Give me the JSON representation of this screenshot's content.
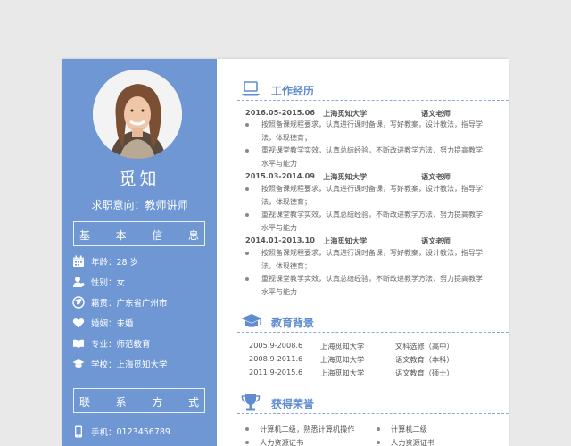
{
  "sidebar": {
    "name": "觅知",
    "intent": "求职意向：教师讲师",
    "basic_title": [
      "基",
      "本",
      "信",
      "息"
    ],
    "info": [
      {
        "icon": "calendar-icon",
        "label": "年龄：",
        "value": " 28 岁"
      },
      {
        "icon": "person-icon",
        "label": "性别：",
        "value": "女"
      },
      {
        "icon": "globe-icon",
        "label": "籍贯：",
        "value": "广东省广州市"
      },
      {
        "icon": "heart-icon",
        "label": "婚姻：",
        "value": "未婚"
      },
      {
        "icon": "book-icon",
        "label": "专业：",
        "value": "师范教育"
      },
      {
        "icon": "graduation-cap-icon",
        "label": "学校：",
        "value": "上海觅知大学"
      }
    ],
    "contact_title": [
      "联",
      "系",
      "方",
      "式"
    ],
    "contact": [
      {
        "icon": "phone-icon",
        "label": "手机：",
        "value": "0123456789"
      }
    ]
  },
  "sections": {
    "work_title": "工作经历",
    "edu_title": "教育背景",
    "honor_title": "获得荣誉"
  },
  "work": [
    {
      "date": "2016.05-2015.06",
      "company": "上海觅知大学",
      "role": "语文老师",
      "bullets": [
        "按照备课规程要求，认真进行课时备课，写好教案，设计教法，指导学法，体现德育；",
        "重视课堂教学实效，认真总结经验，不断改进教学方法，努力提高教学水平与能力"
      ]
    },
    {
      "date": "2015.03-2014.09",
      "company": "上海觅知大学",
      "role": "语文老师",
      "bullets": [
        "按照备课规程要求，认真进行课时备课，写好教案，设计教法，指导学法，体现德育；",
        "重视课堂教学实效，认真总结经验，不断改进教学方法，努力提高教学水平与能力"
      ]
    },
    {
      "date": "2014.01-2013.10",
      "company": "上海觅知大学",
      "role": "语文老师",
      "bullets": [
        "按照备课规程要求，认真进行课时备课，写好教案，设计教法，指导学法，体现德育；",
        "重视课堂教学实效，认真总结经验，不断改进教学方法，努力提高教学水平与能力"
      ]
    }
  ],
  "education": [
    {
      "date": "2005.9-2008.6",
      "school": "上海觅知大学",
      "major": "文科选修（高中）"
    },
    {
      "date": "2008.9-2011.6",
      "school": "上海觅知大学",
      "major": "语文教育（本科）"
    },
    {
      "date": "2011.9-2015.6",
      "school": "上海觅知大学",
      "major": "语文教育（硕士）"
    }
  ],
  "honors": [
    "计算机二级，熟悉计算机操作",
    "计算机二级",
    "人力资源证书",
    "人力资源证书"
  ],
  "colors": {
    "accent": "#6f97d4",
    "title": "#5f8dd0"
  }
}
